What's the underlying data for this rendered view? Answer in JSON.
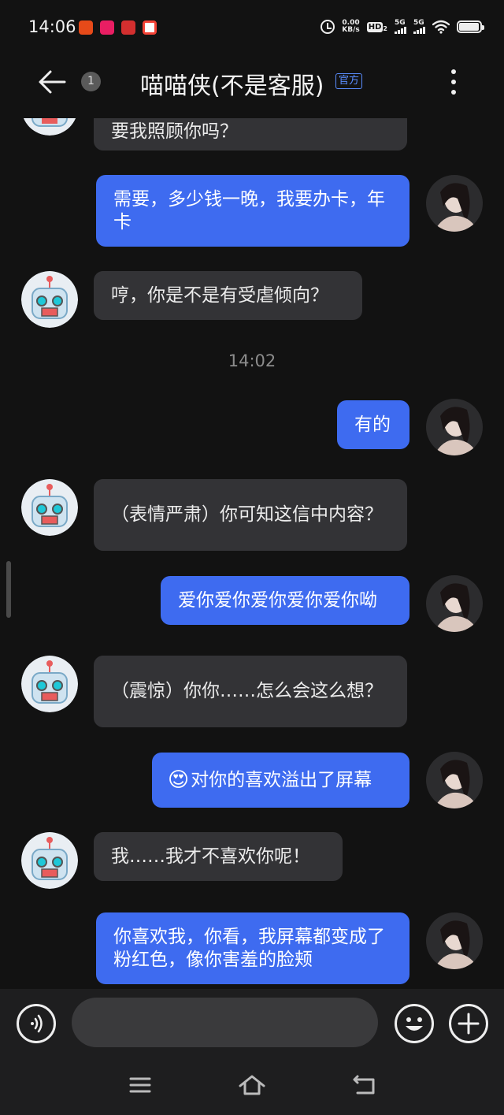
{
  "status_bar": {
    "time": "14:06",
    "net_speed_value": "0.00",
    "net_speed_unit": "KB/s",
    "hd_label": "HD",
    "hd_sub": "2",
    "sig1_label": "5G",
    "sig2_label": "5G",
    "battery_level": 0.88
  },
  "header": {
    "title": "喵喵侠(不是客服)",
    "official_badge": "官方",
    "unread_count": "1"
  },
  "messages": [
    {
      "side": "in",
      "text": "要我照顾你吗？"
    },
    {
      "side": "out",
      "text": "需要，多少钱一晚，我要办卡，年卡"
    },
    {
      "side": "in",
      "text": "哼，你是不是有受虐倾向？"
    },
    {
      "type": "timestamp",
      "text": "14:02"
    },
    {
      "side": "out",
      "text": "有的"
    },
    {
      "side": "in",
      "text": "（表情严肃）你可知这信中内容？"
    },
    {
      "side": "out",
      "text": "爱你爱你爱你爱你爱你呦"
    },
    {
      "side": "in",
      "text": "（震惊）你你……怎么会这么想？"
    },
    {
      "side": "out",
      "emoji": "😍",
      "text": "对你的喜欢溢出了屏幕"
    },
    {
      "side": "in",
      "text": "我……我才不喜欢你呢！"
    },
    {
      "side": "out",
      "text": "你喜欢我，你看，我屏幕都变成了粉红色，像你害羞的脸颊"
    }
  ],
  "input_bar": {
    "placeholder": ""
  },
  "colors": {
    "background": "#121212",
    "incoming_bubble": "#333336",
    "outgoing_bubble": "#3e6bf0",
    "official_badge": "#5a8dff",
    "timestamp": "#8c8c8c"
  },
  "icons": {
    "back": "arrow-left-icon",
    "more": "vertical-dots-icon",
    "voice": "voice-wave-icon",
    "emoji": "smiley-icon",
    "add": "plus-icon",
    "nav_menu": "hamburger-icon",
    "nav_home": "home-icon",
    "nav_back": "return-icon"
  }
}
